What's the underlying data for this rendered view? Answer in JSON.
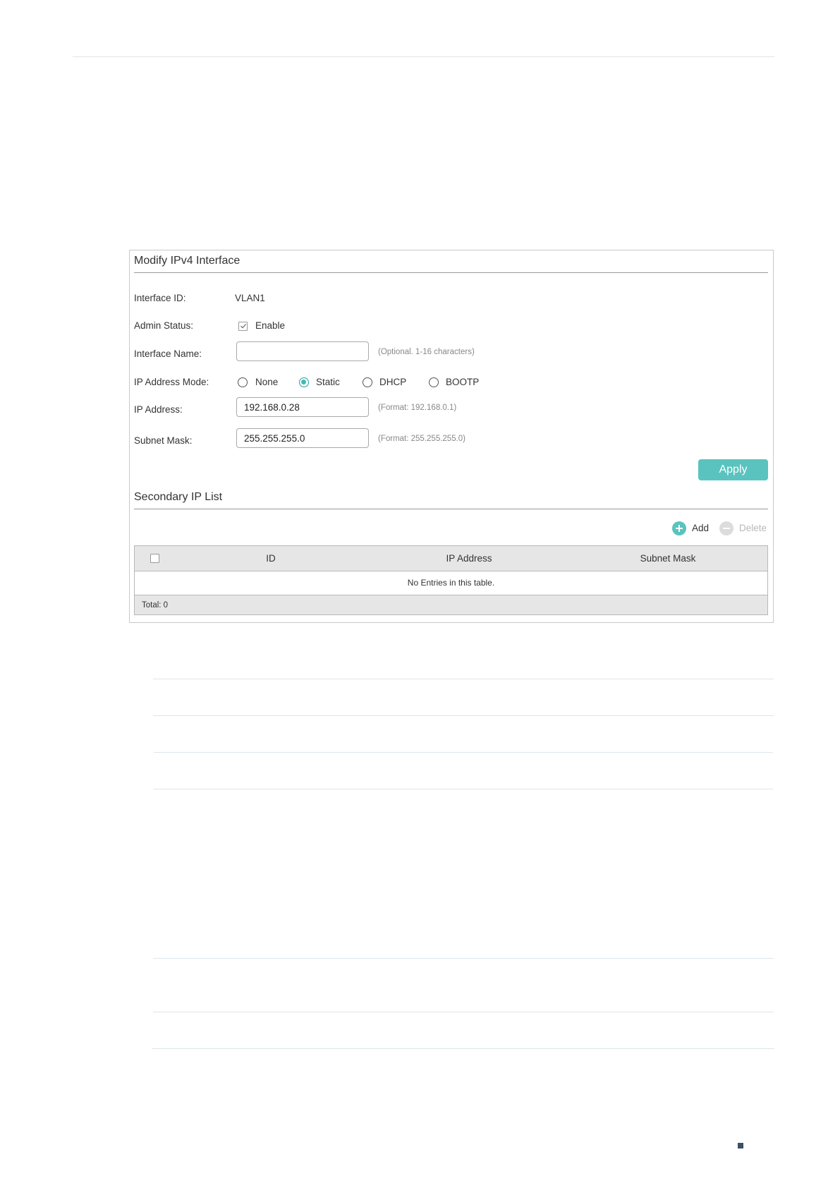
{
  "ipv4_interface": {
    "title": "Modify IPv4 Interface",
    "interface_id_label": "Interface ID:",
    "interface_id_value": "VLAN1",
    "admin_status_label": "Admin Status:",
    "admin_status_option": "Enable",
    "admin_status_checked": true,
    "interface_name_label": "Interface Name:",
    "interface_name_value": "",
    "interface_name_hint": "(Optional. 1-16 characters)",
    "ip_mode_label": "IP Address Mode:",
    "ip_mode_options": [
      "None",
      "Static",
      "DHCP",
      "BOOTP"
    ],
    "ip_mode_selected": "Static",
    "ip_address_label": "IP Address:",
    "ip_address_value": "192.168.0.28",
    "ip_address_hint": "(Format: 192.168.0.1)",
    "subnet_mask_label": "Subnet Mask:",
    "subnet_mask_value": "255.255.255.0",
    "subnet_mask_hint": "(Format: 255.255.255.0)",
    "apply_label": "Apply"
  },
  "secondary_ip": {
    "title": "Secondary IP List",
    "add_label": "Add",
    "delete_label": "Delete",
    "columns": [
      "ID",
      "IP Address",
      "Subnet Mask"
    ],
    "empty_text": "No Entries in this table.",
    "total_label": "Total: 0"
  },
  "colors": {
    "accent": "#5ac3bf",
    "radio_checked": "#3bbdb7",
    "page_marker": "#3d4f64"
  }
}
